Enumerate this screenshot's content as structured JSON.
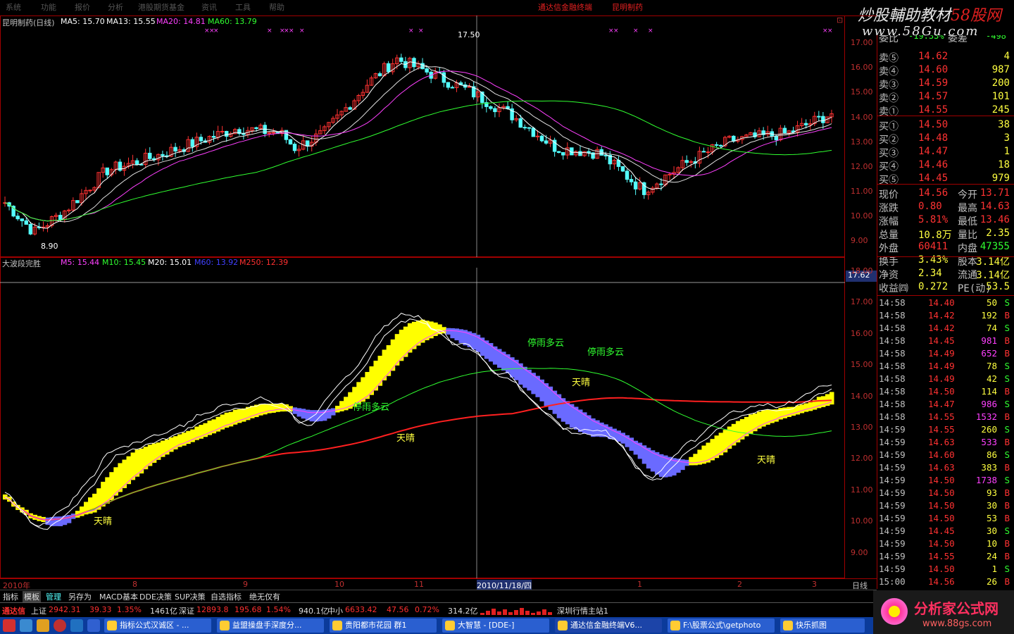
{
  "menu": [
    "系统",
    "功能",
    "报价",
    "分析",
    "港股期货基金",
    "资讯",
    "工具",
    "帮助"
  ],
  "app_title": "通达信金融终端",
  "stock_title": "昆明制药",
  "watermark": {
    "line1_a": "炒股輔助教材",
    "line1_b": "58股网",
    "line2": "www.58Gu.com"
  },
  "upper": {
    "header_name": "昆明制药(日线)",
    "ma5": "MA5: 15.70",
    "ma13": "MA13: 15.55",
    "ma20": "MA20: 14.81",
    "ma60": "MA60: 13.79",
    "peak_label": "17.50",
    "low_label": "8.90",
    "axis": [
      "17.00",
      "16.00",
      "15.00",
      "14.00",
      "13.00",
      "12.00",
      "11.00",
      "10.00",
      "9.00"
    ],
    "corner": "⊡"
  },
  "lower": {
    "header_name": "大波段完胜",
    "m5": "M5: 15.44",
    "m10": "M10: 15.45",
    "m20": "M20: 15.01",
    "m60": "M60: 13.92",
    "m250": "M250: 12.39",
    "cursor_value": "17.62",
    "axis": [
      "18.00",
      "17.00",
      "16.00",
      "15.00",
      "14.00",
      "13.00",
      "12.00",
      "11.00",
      "10.00",
      "9.00"
    ],
    "annotations": {
      "sunny": "天晴",
      "cloudy": "停雨多云"
    }
  },
  "quote": {
    "top_partial": {
      "label1": "委比",
      "v1": "-19.33%",
      "label2": "委差",
      "v2": "-498"
    },
    "sells": [
      {
        "label": "卖⑤",
        "price": "14.62",
        "vol": "4"
      },
      {
        "label": "卖④",
        "price": "14.60",
        "vol": "987"
      },
      {
        "label": "卖③",
        "price": "14.59",
        "vol": "200"
      },
      {
        "label": "卖②",
        "price": "14.57",
        "vol": "101"
      },
      {
        "label": "卖①",
        "price": "14.55",
        "vol": "245"
      }
    ],
    "buys": [
      {
        "label": "买①",
        "price": "14.50",
        "vol": "38"
      },
      {
        "label": "买②",
        "price": "14.48",
        "vol": "3"
      },
      {
        "label": "买③",
        "price": "14.47",
        "vol": "1"
      },
      {
        "label": "买④",
        "price": "14.46",
        "vol": "18"
      },
      {
        "label": "买⑤",
        "price": "14.45",
        "vol": "979"
      }
    ],
    "stats": [
      {
        "l1": "现价",
        "v1": "14.56",
        "l2": "今开",
        "v2": "13.71"
      },
      {
        "l1": "涨跌",
        "v1": "0.80",
        "l2": "最高",
        "v2": "14.63"
      },
      {
        "l1": "涨幅",
        "v1": "5.81%",
        "l2": "最低",
        "v2": "13.46"
      },
      {
        "l1": "总量",
        "v1": "10.8万",
        "l2": "量比",
        "v2": "2.35"
      },
      {
        "l1": "外盘",
        "v1": "60411",
        "l2": "内盘",
        "v2": "47355"
      },
      {
        "l1": "换手",
        "v1": "3.43%",
        "l2": "股本",
        "v2": "3.14亿"
      },
      {
        "l1": "净资",
        "v1": "2.34",
        "l2": "流通",
        "v2": "3.14亿"
      },
      {
        "l1": "收益㈣",
        "v1": "0.272",
        "l2": "PE(动)",
        "v2": "53.5"
      }
    ],
    "ticks": [
      {
        "t": "14:58",
        "p": "14.40",
        "v": "50",
        "s": "S"
      },
      {
        "t": "14:58",
        "p": "14.42",
        "v": "192",
        "s": "B"
      },
      {
        "t": "14:58",
        "p": "14.42",
        "v": "74",
        "s": "S"
      },
      {
        "t": "14:58",
        "p": "14.45",
        "v": "981",
        "s": "B"
      },
      {
        "t": "14:58",
        "p": "14.49",
        "v": "652",
        "s": "B"
      },
      {
        "t": "14:58",
        "p": "14.49",
        "v": "78",
        "s": "S"
      },
      {
        "t": "14:58",
        "p": "14.49",
        "v": "42",
        "s": "S"
      },
      {
        "t": "14:58",
        "p": "14.50",
        "v": "114",
        "s": "B"
      },
      {
        "t": "14:58",
        "p": "14.47",
        "v": "986",
        "s": "S"
      },
      {
        "t": "14:58",
        "p": "14.55",
        "v": "1532",
        "s": "B"
      },
      {
        "t": "14:59",
        "p": "14.55",
        "v": "260",
        "s": "S"
      },
      {
        "t": "14:59",
        "p": "14.63",
        "v": "533",
        "s": "B"
      },
      {
        "t": "14:59",
        "p": "14.60",
        "v": "86",
        "s": "S"
      },
      {
        "t": "14:59",
        "p": "14.63",
        "v": "383",
        "s": "B"
      },
      {
        "t": "14:59",
        "p": "14.50",
        "v": "1738",
        "s": "S"
      },
      {
        "t": "14:59",
        "p": "14.50",
        "v": "93",
        "s": "B"
      },
      {
        "t": "14:59",
        "p": "14.50",
        "v": "30",
        "s": "B"
      },
      {
        "t": "14:59",
        "p": "14.50",
        "v": "53",
        "s": "B"
      },
      {
        "t": "14:59",
        "p": "14.45",
        "v": "30",
        "s": "S"
      },
      {
        "t": "14:59",
        "p": "14.50",
        "v": "10",
        "s": "B"
      },
      {
        "t": "14:59",
        "p": "14.55",
        "v": "24",
        "s": "B"
      },
      {
        "t": "14:59",
        "p": "14.50",
        "v": "1",
        "s": "S"
      },
      {
        "t": "15:00",
        "p": "14.56",
        "v": "26",
        "s": "B"
      }
    ]
  },
  "xaxis": {
    "labels": [
      "2010年",
      "8",
      "9",
      "10",
      "11",
      "1",
      "2",
      "3"
    ],
    "cursor": "2010/11/18/四",
    "right": "日线"
  },
  "tabs": [
    "指标",
    "模板",
    "管理",
    "另存为",
    "MACD基本",
    "DDE决策",
    "SUP决策",
    "自选指标",
    "绝无仅有"
  ],
  "status": {
    "brand": "通达信",
    "sh_label": "上证",
    "sh_val": "2942.31",
    "sh_chg": "39.33",
    "sh_pct": "1.35%",
    "sh_amt": "1461亿",
    "sz_label": "深证",
    "sz_val": "12893.8",
    "sz_chg": "195.68",
    "sz_pct": "1.54%",
    "sz_amt": "940.1亿",
    "zx_label": "中小",
    "zx_val": "6633.42",
    "zx_chg": "47.56",
    "zx_pct": "0.72%",
    "zx_amt": "314.2亿",
    "station": "深圳行情主站1"
  },
  "taskbar": [
    "指标公式汉诚区 - ...",
    "益盟操盘手深度分...",
    "贵阳都市花园 群1",
    "大智慧 - [DDE-]",
    "通达信金融终端V6...",
    "F:\\股票公式\\getphoto",
    "快乐抓图"
  ],
  "logo": {
    "name": "分析家公式网",
    "url": "www.88gs.com"
  },
  "colors": {
    "up": "#ff3232",
    "down": "#54ffff",
    "ma5": "#ffffff",
    "ma20": "#ff40ff",
    "ma60": "#30ff30",
    "yellow": "#ffff00",
    "blue": "#6a6aff",
    "m250": "#ff2020"
  }
}
